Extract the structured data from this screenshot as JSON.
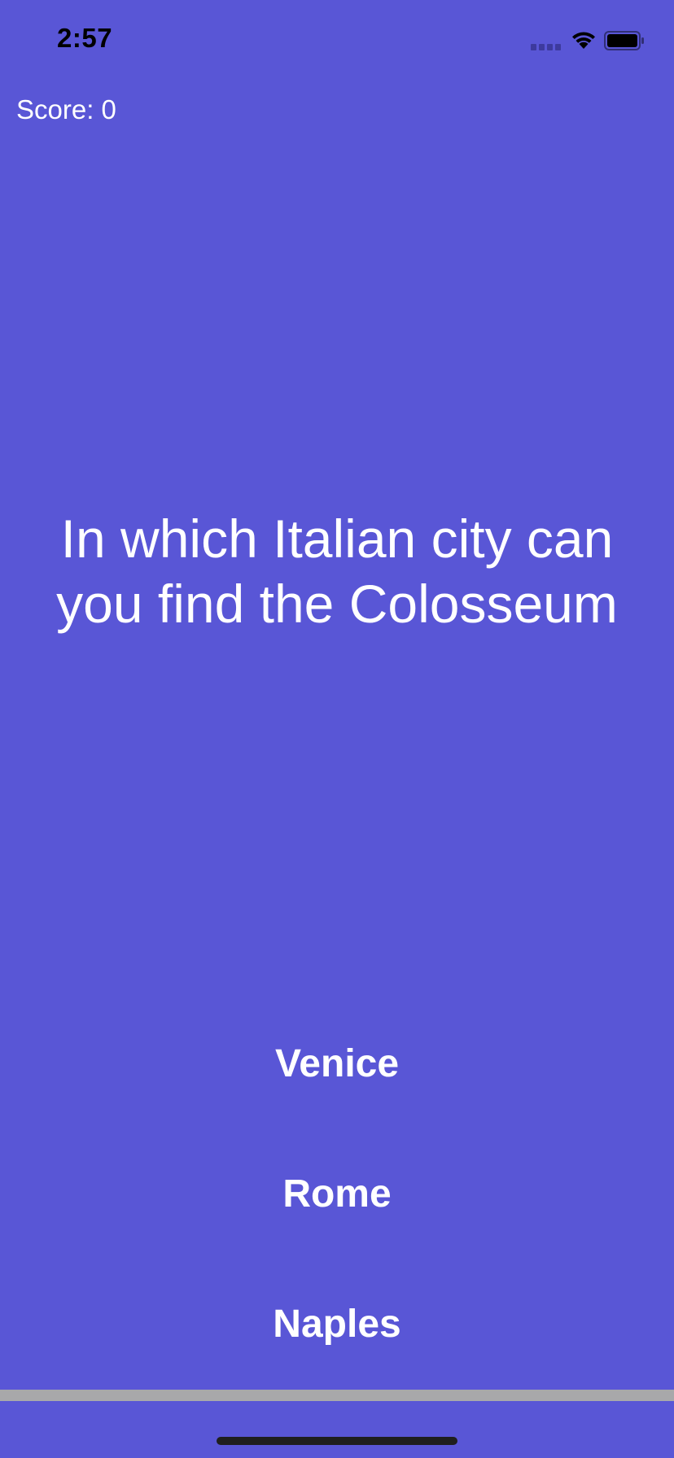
{
  "status_bar": {
    "time": "2:57",
    "icons": [
      "signal-icon",
      "wifi-icon",
      "battery-icon"
    ]
  },
  "score": {
    "label": "Score: 0"
  },
  "question": {
    "text": "In which Italian city can you find the Colosseum"
  },
  "answers": [
    {
      "label": "Venice"
    },
    {
      "label": "Rome"
    },
    {
      "label": "Naples"
    }
  ],
  "progress": {
    "fraction": 0.0
  },
  "colors": {
    "background": "#5956D6",
    "text": "#FFFFFF",
    "progress_track": "#A8A8AA",
    "status_text": "#000000"
  }
}
